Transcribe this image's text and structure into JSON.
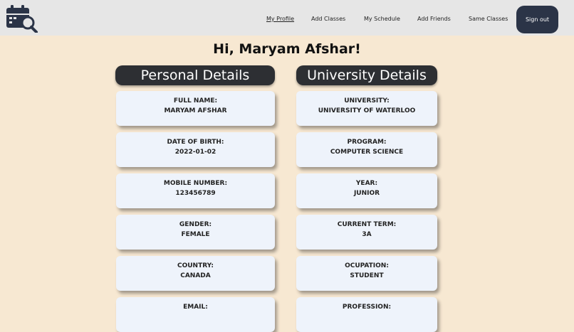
{
  "nav": {
    "links": [
      "My Profile",
      "Add Classes",
      "My Schedule",
      "Add Friends",
      "Same Classes"
    ],
    "signout": "Sign out"
  },
  "greeting": "Hi, Maryam Afshar!",
  "personal": {
    "title": "Personal Details",
    "items": [
      {
        "label": "FULL NAME:",
        "value": "MARYAM AFSHAR"
      },
      {
        "label": "DATE OF BIRTH:",
        "value": "2022-01-02"
      },
      {
        "label": "MOBILE NUMBER:",
        "value": "123456789"
      },
      {
        "label": "GENDER:",
        "value": "FEMALE"
      },
      {
        "label": "COUNTRY:",
        "value": "CANADA"
      },
      {
        "label": "EMAIL:",
        "value": ""
      }
    ]
  },
  "university": {
    "title": "University Details",
    "items": [
      {
        "label": "UNIVERSITY:",
        "value": "UNIVERSITY OF WATERLOO"
      },
      {
        "label": "PROGRAM:",
        "value": "COMPUTER SCIENCE"
      },
      {
        "label": "YEAR:",
        "value": "JUNIOR"
      },
      {
        "label": "CURRENT TERM:",
        "value": "3A"
      },
      {
        "label": "OCUPATION:",
        "value": "STUDENT"
      },
      {
        "label": "PROFESSION:",
        "value": ""
      }
    ]
  }
}
